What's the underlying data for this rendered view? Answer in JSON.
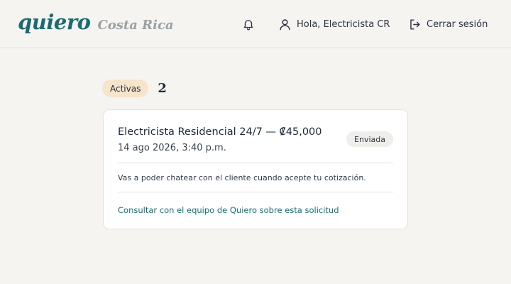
{
  "brand": {
    "name": "quiero",
    "country": "Costa Rica"
  },
  "nav": {
    "notifications_icon": "bell-icon",
    "user_icon": "user-icon",
    "greeting": "Hola, Electricista CR",
    "logout_icon": "logout-icon",
    "logout_label": "Cerrar sesión"
  },
  "filter": {
    "label": "Activas",
    "count": "2"
  },
  "request": {
    "title": "Electricista Residencial 24/7 — ₡45,000",
    "date": "14 ago 2026, 3:40 p.m.",
    "status": "Enviada",
    "note": "Vas a poder chatear con el cliente cuando acepte tu cotización.",
    "support_link": "Consultar con el equipo de Quiero sobre esta solicitud"
  },
  "colors": {
    "brand": "#1a6b72",
    "background": "#f6f4f0",
    "pill": "#f6e4cb",
    "badge": "#efeeeb"
  }
}
